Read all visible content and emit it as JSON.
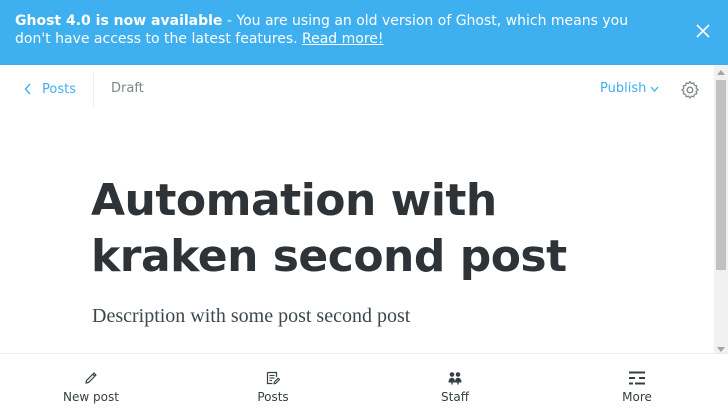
{
  "banner": {
    "title": "Ghost 4.0 is now available",
    "message": " - You are using an old version of Ghost, which means you don't have access to the latest features. ",
    "link": "Read more!",
    "background": "#3eb0ef",
    "close_icon": "close-icon"
  },
  "header": {
    "back_label": "Posts",
    "status": "Draft",
    "publish_label": "Publish",
    "settings_icon": "gear-icon"
  },
  "post": {
    "title": "Automation with kraken second post",
    "excerpt": "Description with some post second post"
  },
  "bottom_nav": {
    "items": [
      {
        "label": "New post",
        "icon": "pencil-icon"
      },
      {
        "label": "Posts",
        "icon": "posts-icon"
      },
      {
        "label": "Staff",
        "icon": "staff-icon"
      },
      {
        "label": "More",
        "icon": "more-icon"
      }
    ]
  },
  "colors": {
    "accent": "#3eb0ef",
    "title_text": "#2e3337",
    "muted_text": "#7d878a"
  }
}
